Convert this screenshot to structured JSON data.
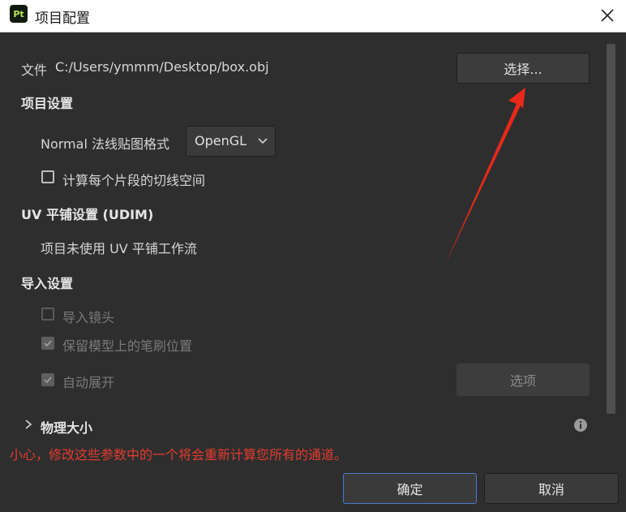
{
  "window": {
    "app_icon_text": "Pt",
    "title": "项目配置"
  },
  "file": {
    "label": "文件",
    "path": "C:/Users/ymmm/Desktop/box.obj",
    "choose_label": "选择..."
  },
  "project_settings": {
    "heading": "项目设置",
    "normal_format_label": "Normal 法线贴图格式",
    "normal_format_value": "OpenGL",
    "tangent_label": "计算每个片段的切线空间",
    "tangent_checked": false
  },
  "uv_settings": {
    "heading": "UV 平铺设置 (UDIM)",
    "status": "项目未使用 UV 平铺工作流"
  },
  "import_settings": {
    "heading": "导入设置",
    "import_camera_label": "导入镜头",
    "import_camera_checked": false,
    "keep_brush_label": "保留模型上的笔刷位置",
    "keep_brush_checked": true,
    "auto_unwrap_label": "自动展开",
    "auto_unwrap_checked": true,
    "options_label": "选项"
  },
  "physical_size": {
    "heading": "物理大小"
  },
  "warning": "小心，修改这些参数中的一个将会重新计算您所有的通道。",
  "footer": {
    "ok_label": "确定",
    "cancel_label": "取消"
  },
  "colors": {
    "accent": "#4a79c9",
    "warning": "#e33b2f",
    "annotation_arrow": "#e8291c"
  }
}
